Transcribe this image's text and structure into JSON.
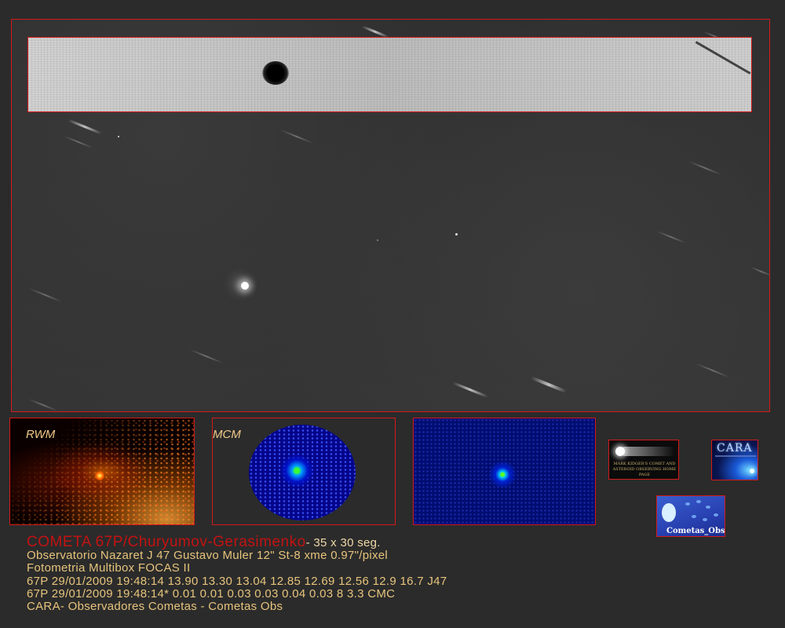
{
  "panels": {
    "rwm_label": "RWM",
    "mcm_label": "MCM"
  },
  "logos": {
    "kidger_text": "MARK KIDGER'S COMET AND ASTEROID OBSERVING HOME PAGE",
    "cara_text": "CARA",
    "cometas_text": "Cometas_Obs"
  },
  "caption": {
    "title": "COMETA 67P/Churyumov-Gerasimenko",
    "exposure": "- 35 x 30 seg.",
    "line2": "Observatorio Nazaret J 47 Gustavo Muler 12\" St-8 xme 0.97\"/pixel",
    "line3": "Fotometria Multibox FOCAS II",
    "line4": "67P 29/01/2009 19:48:14 13.90 13.30 13.04 12.85 12.69 12.56 12.9 16.7 J47",
    "line5": "67P 29/01/2009 19:48:14* 0.01 0.01 0.03 0.03 0.04 0.03 8 3.3 CMC",
    "line6": "CARA- Observadores Cometas - Cometas Obs"
  },
  "colors": {
    "background": "#2b2b2b",
    "frame": "#d41a1a",
    "caption": "#e7c47c",
    "title": "#c41212"
  }
}
